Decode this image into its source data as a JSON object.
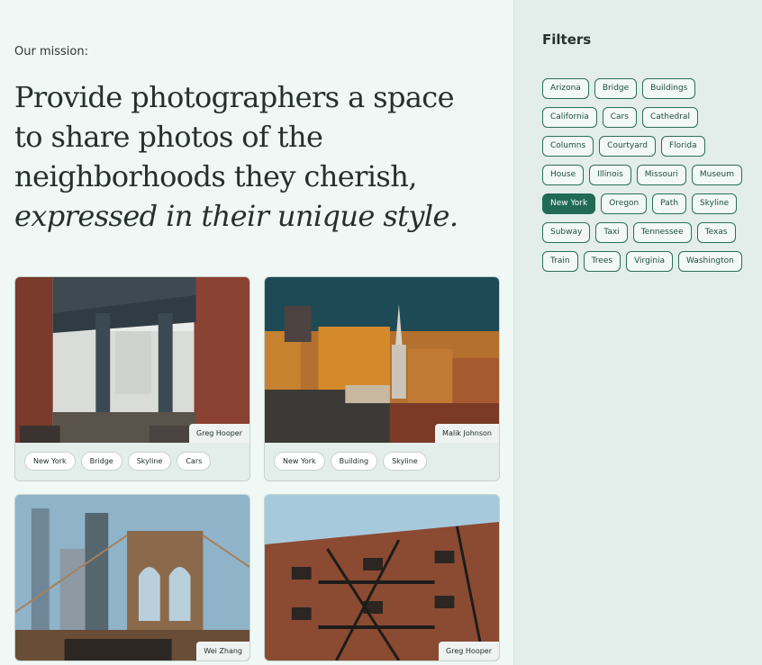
{
  "mission": {
    "label": "Our mission:",
    "line1": "Provide photographers a space",
    "line2": "to share photos of the",
    "line3": "neighborhoods they cherish,",
    "line4": "expressed in their unique style."
  },
  "cards": [
    {
      "credit": "Greg Hooper",
      "tags": [
        "New York",
        "Bridge",
        "Skyline",
        "Cars"
      ]
    },
    {
      "credit": "Malik Johnson",
      "tags": [
        "New York",
        "Building",
        "Skyline"
      ]
    },
    {
      "credit": "Wei Zhang",
      "tags": []
    },
    {
      "credit": "Greg Hooper",
      "tags": []
    }
  ],
  "filters": {
    "title": "Filters",
    "items": [
      "Arizona",
      "Bridge",
      "Buildings",
      "California",
      "Cars",
      "Cathedral",
      "Columns",
      "Courtyard",
      "Florida",
      "House",
      "Illinois",
      "Missouri",
      "Museum",
      "New York",
      "Oregon",
      "Path",
      "Skyline",
      "Subway",
      "Taxi",
      "Tennessee",
      "Texas",
      "Train",
      "Trees",
      "Virginia",
      "Washington"
    ],
    "selected": "New York"
  },
  "colors": {
    "accent": "#216b55",
    "page_bg": "#eff8f4",
    "sidebar_bg": "#e3ede9"
  }
}
